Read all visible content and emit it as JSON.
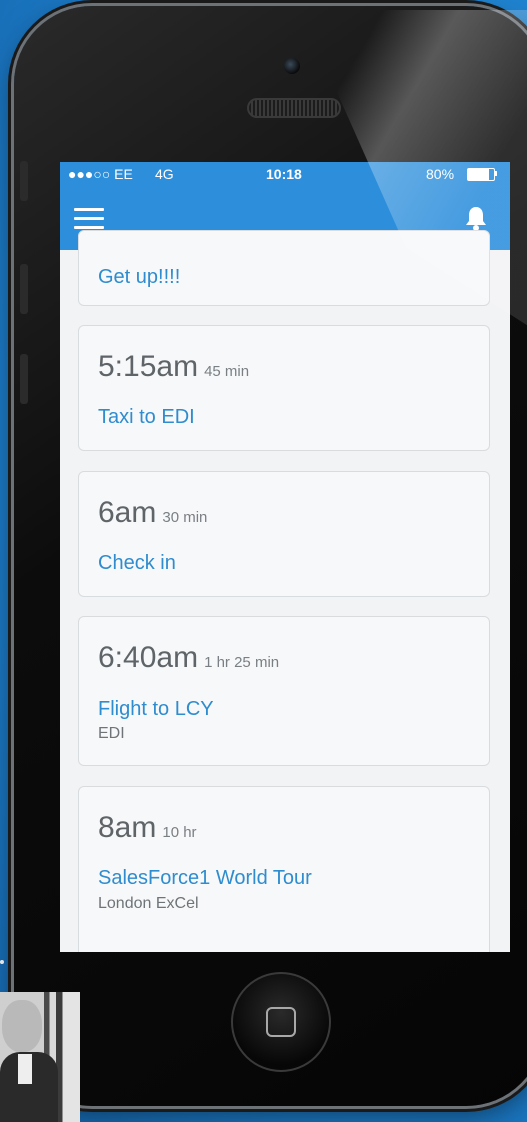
{
  "status_bar": {
    "carrier": "●●●○○ EE",
    "network": "4G",
    "time": "10:18",
    "battery": "80%"
  },
  "nav": {
    "menu_icon": "hamburger-icon",
    "bell_icon": "bell-icon"
  },
  "first_card_title": "Get up!!!!",
  "events": [
    {
      "time": "5:15am",
      "duration": "45 min",
      "title": "Taxi to EDI",
      "location": ""
    },
    {
      "time": "6am",
      "duration": "30 min",
      "title": "Check in",
      "location": ""
    },
    {
      "time": "6:40am",
      "duration": "1 hr 25 min",
      "title": "Flight to LCY",
      "location": "EDI"
    },
    {
      "time": "8am",
      "duration": "10 hr",
      "title": "SalesForce1 World Tour",
      "location": "London ExCel"
    }
  ],
  "colors": {
    "accent": "#2d8fdc",
    "link": "#2e8ccf",
    "card_bg": "#f7f8f9"
  }
}
